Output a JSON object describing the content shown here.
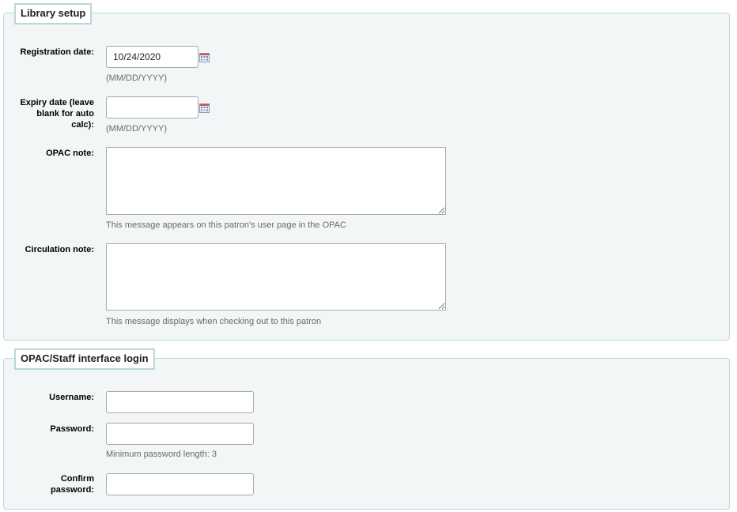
{
  "library_setup": {
    "legend": "Library setup",
    "registration_label": "Registration date:",
    "registration_value": "10/24/2020",
    "registration_hint": "(MM/DD/YYYY)",
    "expiry_label_1": "Expiry date (leave",
    "expiry_label_2": "blank for auto",
    "expiry_label_3": "calc):",
    "expiry_value": "",
    "expiry_hint": "(MM/DD/YYYY)",
    "opac_note_label": "OPAC note:",
    "opac_note_hint": "This message appears on this patron's user page in the OPAC",
    "circ_note_label": "Circulation note:",
    "circ_note_hint": "This message displays when checking out to this patron",
    "calendar_icon": "calendar-icon"
  },
  "login": {
    "legend": "OPAC/Staff interface login",
    "username_label": "Username:",
    "password_label": "Password:",
    "password_hint": "Minimum password length: 3",
    "confirm_label_1": "Confirm",
    "confirm_label_2": "password:"
  }
}
